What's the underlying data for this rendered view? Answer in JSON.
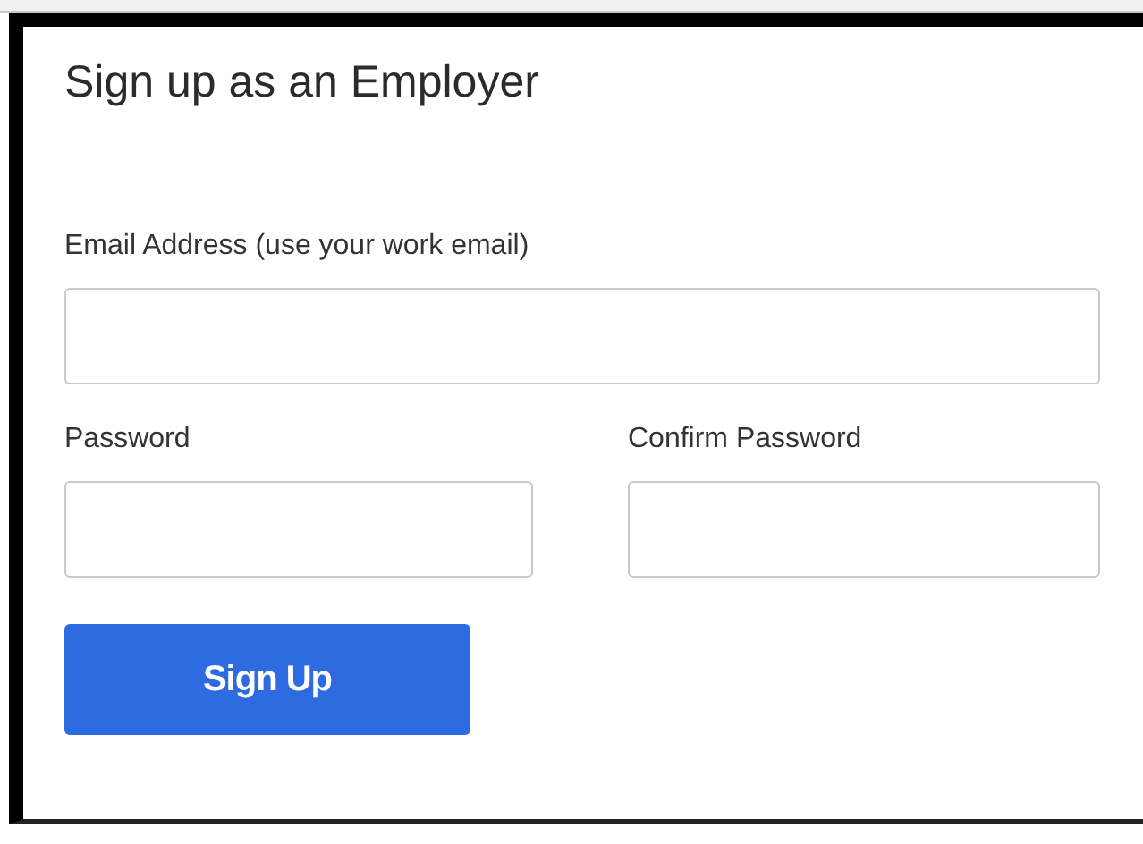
{
  "title": "Sign up as an Employer",
  "fields": [
    {
      "label": "Email Address (use your work email)"
    },
    {
      "label": "Password"
    },
    {
      "label": "Confirm Password"
    }
  ],
  "button": "Sign Up"
}
